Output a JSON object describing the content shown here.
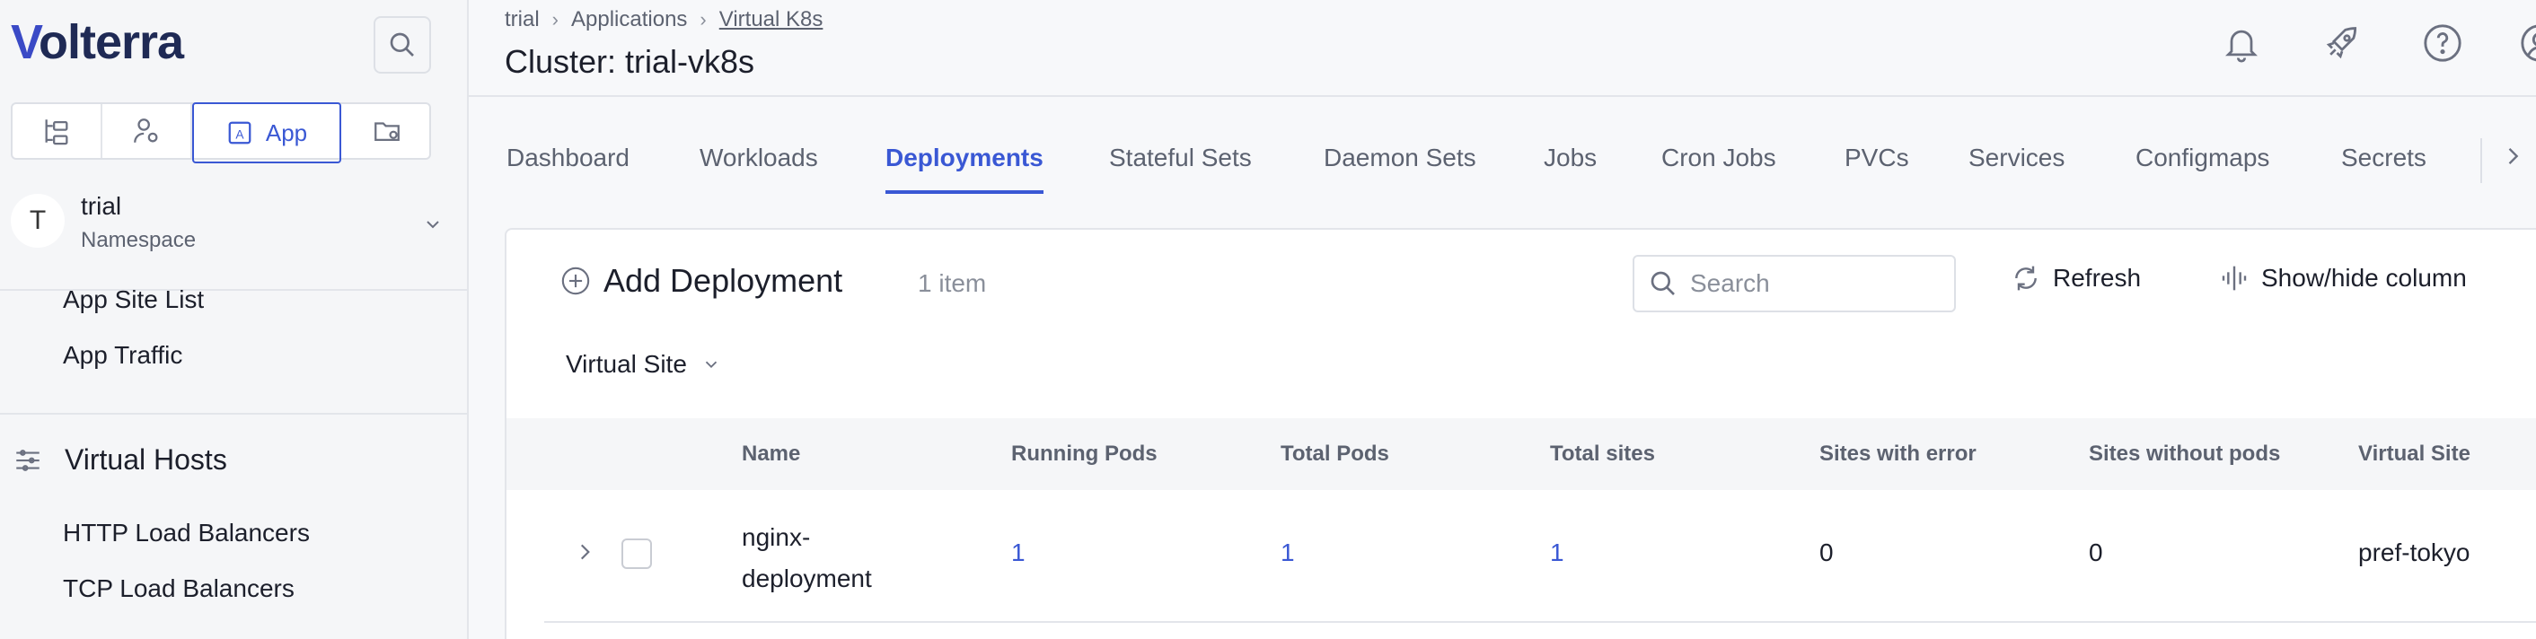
{
  "sidebar": {
    "logo_text": "olterra",
    "logo_v": "V",
    "modes": [
      {
        "icon": "tree-icon"
      },
      {
        "icon": "user-settings-icon"
      },
      {
        "icon": "app-icon",
        "label": "App"
      },
      {
        "icon": "folder-settings-icon"
      }
    ],
    "namespace": {
      "avatar": "T",
      "name": "trial",
      "label": "Namespace"
    },
    "links_top": [
      "App Site List",
      "App Traffic"
    ],
    "group": {
      "label": "Virtual Hosts",
      "icon": "virtual-hosts-icon"
    },
    "links_bottom": [
      "HTTP Load Balancers",
      "TCP Load Balancers"
    ]
  },
  "header": {
    "breadcrumb": [
      "trial",
      "Applications",
      "Virtual K8s"
    ],
    "title": "Cluster: trial-vk8s"
  },
  "tabs": [
    "Dashboard",
    "Workloads",
    "Deployments",
    "Stateful Sets",
    "Daemon Sets",
    "Jobs",
    "Cron Jobs",
    "PVCs",
    "Services",
    "Configmaps",
    "Secrets"
  ],
  "active_tab": "Deployments",
  "toolbar": {
    "add_label": "Add Deployment",
    "count": "1 item",
    "search_placeholder": "Search",
    "refresh_label": "Refresh",
    "showhide_label": "Show/hide column",
    "filter_label": "Virtual Site"
  },
  "table": {
    "columns": [
      "Name",
      "Running Pods",
      "Total Pods",
      "Total sites",
      "Sites with error",
      "Sites without pods",
      "Virtual Site"
    ],
    "rows": [
      {
        "name_line1": "nginx-",
        "name_line2": "deployment",
        "running_pods": "1",
        "total_pods": "1",
        "total_sites": "1",
        "sites_with_error": "0",
        "sites_without_pods": "0",
        "virtual_site": "pref-tokyo"
      }
    ]
  },
  "colors": {
    "accent": "#3a58d4",
    "logo": "#1f2a55",
    "text": "#1c1f2b",
    "muted": "#5c6270"
  }
}
